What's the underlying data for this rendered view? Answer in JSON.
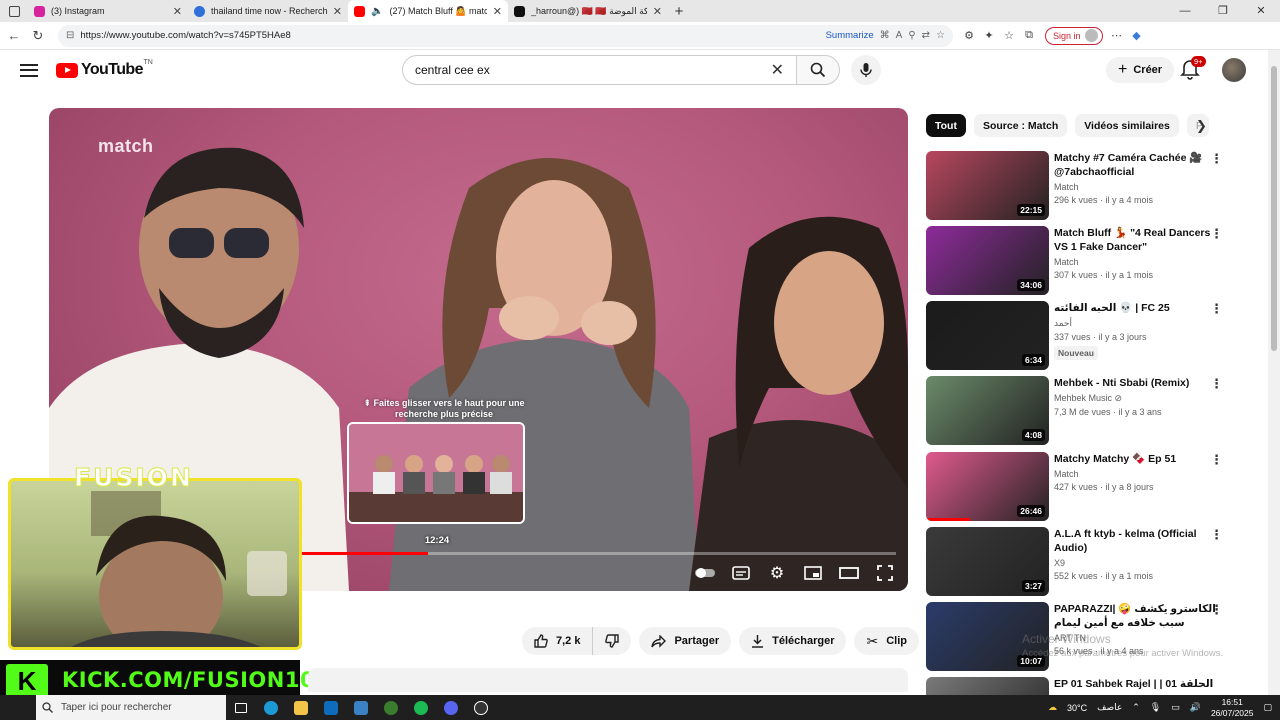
{
  "browser": {
    "tabs": [
      {
        "title": "(3) Instagram",
        "favicon_color": "#d6249f",
        "active": false
      },
      {
        "title": "thailand time now - Recherche",
        "favicon_color": "#2e6fd8",
        "active": false
      },
      {
        "title": "(27) Match Bluff 🤷 match t",
        "favicon_color": "#ff0000",
        "active": true
      },
      {
        "title": "_harroun@) 🇲🇦 🇲🇦 ملكة الموضة",
        "favicon_color": "#111111",
        "active": false
      }
    ],
    "url": "https://www.youtube.com/watch?v=s745PT5HAe8",
    "summarize_label": "Summarize",
    "signin_label": "Sign in"
  },
  "youtube": {
    "logo_text": "YouTube",
    "country_code": "TN",
    "search_value": "central cee ex",
    "create_label": "Créer",
    "notif_count": "9+"
  },
  "player": {
    "watermark": "match",
    "seek_hint": "⇞ Faites glisser vers le haut pour une recherche plus précise",
    "preview_time": "12:24",
    "progress": 0.44
  },
  "actions": {
    "likes": "7,2 k",
    "share": "Partager",
    "download": "Télécharger",
    "clip": "Clip"
  },
  "overlay": {
    "title": "FUSION",
    "kick_text": "KICK.COM/FUSION10",
    "kick_letter": "K"
  },
  "sidebar": {
    "chips": [
      "Tout",
      "Source : Match",
      "Vidéos similaires",
      "P"
    ],
    "videos": [
      {
        "title": "Matchy #7 Caméra Cachée 🎥 @7abchaofficial",
        "channel": "Match",
        "meta": "296 k vues · il y a 4 mois",
        "duration": "22:15",
        "bg": "#b9475f",
        "watched": 0
      },
      {
        "title": "Match Bluff 💃 \"4 Real Dancers VS 1 Fake Dancer\"",
        "channel": "Match",
        "meta": "307 k vues · il y a 1 mois",
        "duration": "34:06",
        "bg": "#8e2b9b",
        "watched": 0
      },
      {
        "title": "الحبه الفائته 💀 | FC 25",
        "channel": "أحمد",
        "meta": "337 vues · il y a 3 jours",
        "duration": "6:34",
        "bg": "#1b1b1b",
        "watched": 0,
        "badge": "Nouveau"
      },
      {
        "title": "Mehbek - Nti Sbabi (Remix)",
        "channel": "Mehbek Music ⊘",
        "meta": "7,3 M de vues · il y a 3 ans",
        "duration": "4:08",
        "bg": "#6b8b6a",
        "watched": 0.0
      },
      {
        "title": "Matchy Matchy 🍫 Ep 51",
        "channel": "Match",
        "meta": "427 k vues · il y a 8 jours",
        "duration": "26:46",
        "bg": "#e05a8d",
        "watched": 0.36
      },
      {
        "title": "A.L.A ft ktyb - kelma (Official Audio)",
        "channel": "X9",
        "meta": "552 k vues · il y a 1 mois",
        "duration": "3:27",
        "bg": "#3a3a3a",
        "watched": 0
      },
      {
        "title": "PAPARAZZI| 🤪 الكاسترو يكشف سبب خلافه مع أمين ليمام",
        "channel": "ART TN",
        "meta": "56 k vues · il y a 4 ans",
        "duration": "10:07",
        "bg": "#2b3c6b",
        "watched": 0
      },
      {
        "title": "EP 01 Sahbek Rajel | | 01 الحلقة",
        "channel": "",
        "meta": "",
        "duration": "",
        "bg": "#7a7a7a",
        "watched": 0
      }
    ]
  },
  "watermark": {
    "line1": "Activer Windows",
    "line2": "Accédez aux paramètres pour activer Windows."
  },
  "taskbar": {
    "search_placeholder": "Taper ici pour rechercher",
    "weather": "30°C",
    "weather_label": "عاصف",
    "time": "16:51",
    "date": "26/07/2025"
  }
}
